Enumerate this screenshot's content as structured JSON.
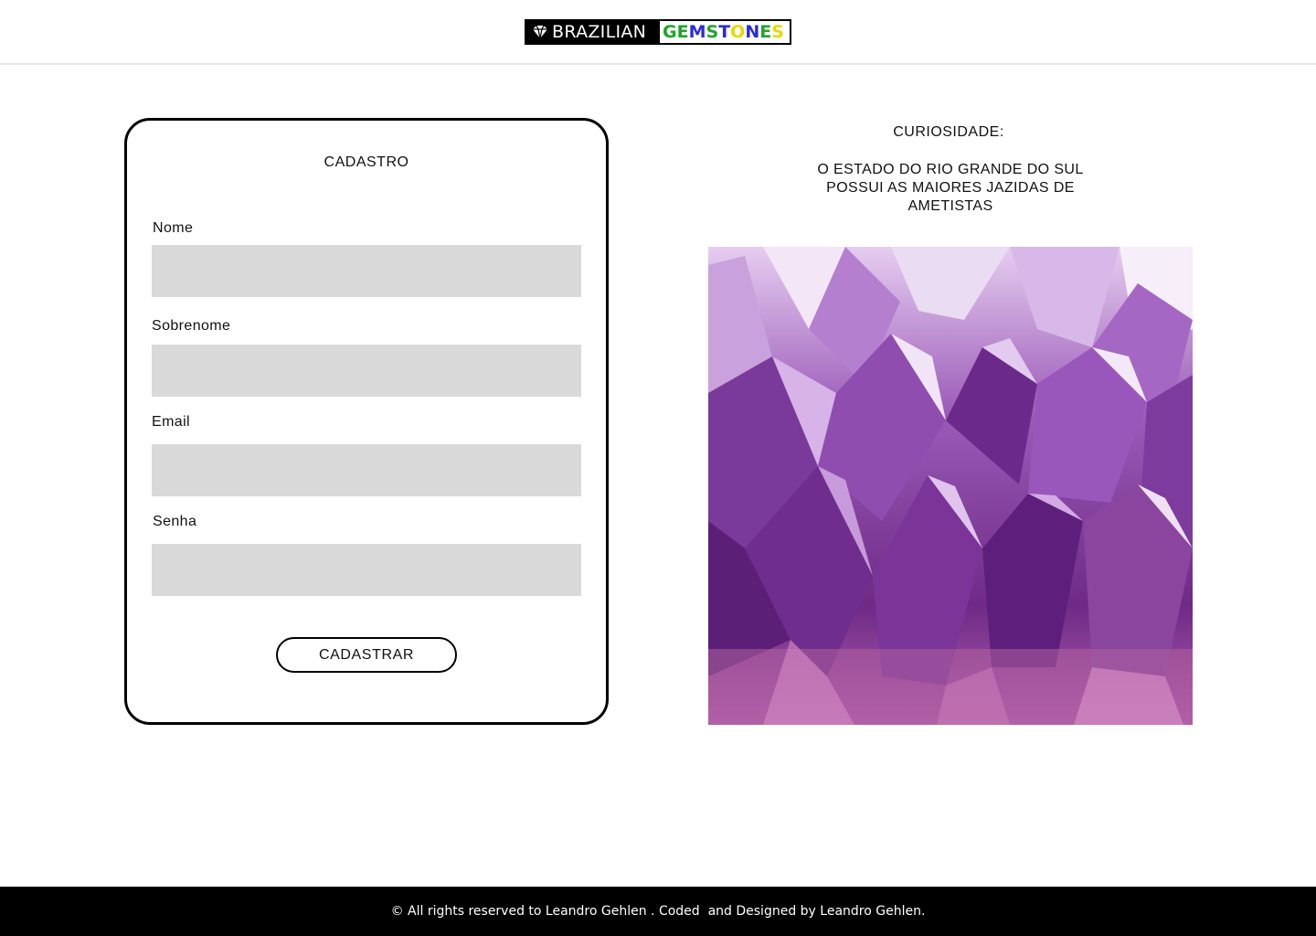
{
  "header": {
    "logo": {
      "icon": "diamond-icon",
      "word_left": "BRAZILIAN",
      "word_right_letters": [
        {
          "char": "G",
          "color": "#1fa526"
        },
        {
          "char": "E",
          "color": "#1fa526"
        },
        {
          "char": "M",
          "color": "#2b2bd6"
        },
        {
          "char": "S",
          "color": "#1fa526"
        },
        {
          "char": "T",
          "color": "#2b2bd6"
        },
        {
          "char": "O",
          "color": "#e8d800"
        },
        {
          "char": "N",
          "color": "#2b2bd6"
        },
        {
          "char": "E",
          "color": "#1fa526"
        },
        {
          "char": "S",
          "color": "#e8d800"
        }
      ]
    }
  },
  "form": {
    "title": "CADASTRO",
    "fields": [
      {
        "label": "Nome",
        "value": "",
        "placeholder": ""
      },
      {
        "label": "Sobrenome",
        "value": "",
        "placeholder": ""
      },
      {
        "label": "Email",
        "value": "",
        "placeholder": ""
      },
      {
        "label": "Senha",
        "value": "",
        "placeholder": ""
      }
    ],
    "submit_label": "CADASTRAR"
  },
  "curiosity": {
    "title": "CURIOSIDADE:",
    "text": "O ESTADO DO RIO GRANDE DO SUL POSSUI AS MAIORES JAZIDAS DE AMETISTAS"
  },
  "footer": {
    "text": "© All rights reserved to Leandro Gehlen . Coded  and Designed by Leandro Gehlen."
  },
  "colors": {
    "input_bg": "#d9d9d9",
    "footer_bg": "#000000",
    "amethyst": "#8a3fa8"
  }
}
